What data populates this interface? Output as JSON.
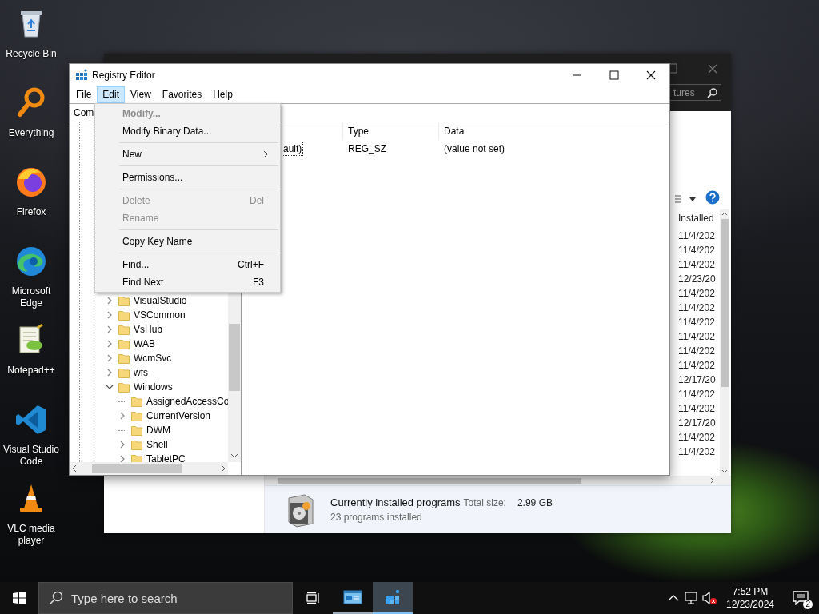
{
  "desktop_icons": [
    {
      "label": "Recycle Bin",
      "kind": "recycle"
    },
    {
      "label": "Everything",
      "kind": "everything"
    },
    {
      "label": "Firefox",
      "kind": "firefox"
    },
    {
      "label": "Microsoft Edge",
      "kind": "edge"
    },
    {
      "label": "Notepad++",
      "kind": "notepad"
    },
    {
      "label": "Visual Studio Code",
      "kind": "vscode"
    },
    {
      "label": "VLC media player",
      "kind": "vlc"
    }
  ],
  "programs_window": {
    "search": {
      "placeholder": "tures"
    },
    "column_header": "Installed",
    "dates": [
      "11/4/202",
      "11/4/202",
      "11/4/202",
      "12/23/20",
      "11/4/202",
      "11/4/202",
      "11/4/202",
      "11/4/202",
      "11/4/202",
      "11/4/202",
      "12/17/20",
      "11/4/202",
      "11/4/202",
      "12/17/20",
      "11/4/202",
      "11/4/202"
    ],
    "details": {
      "title": "Currently installed programs",
      "size_label": "Total size:",
      "size": "2.99 GB",
      "count": "23 programs installed"
    }
  },
  "registry_editor": {
    "title": "Registry Editor",
    "menus": [
      {
        "label": "File",
        "selected": false
      },
      {
        "label": "Edit",
        "selected": true
      },
      {
        "label": "View",
        "selected": false
      },
      {
        "label": "Favorites",
        "selected": false
      },
      {
        "label": "Help",
        "selected": false
      }
    ],
    "address": "Com",
    "tree": [
      {
        "label": "VisualStudio",
        "expandable": true,
        "expanded": false
      },
      {
        "label": "VSCommon",
        "expandable": true,
        "expanded": false
      },
      {
        "label": "VsHub",
        "expandable": true,
        "expanded": false
      },
      {
        "label": "WAB",
        "expandable": true,
        "expanded": false
      },
      {
        "label": "WcmSvc",
        "expandable": true,
        "expanded": false
      },
      {
        "label": "wfs",
        "expandable": true,
        "expanded": false
      },
      {
        "label": "Windows",
        "expandable": true,
        "expanded": true,
        "children": [
          {
            "label": "AssignedAccessCo",
            "expandable": false
          },
          {
            "label": "CurrentVersion",
            "expandable": true,
            "expanded": false
          },
          {
            "label": "DWM",
            "expandable": false
          },
          {
            "label": "Shell",
            "expandable": true,
            "expanded": false
          },
          {
            "label": "TabletPC",
            "expandable": true,
            "expanded": false
          }
        ]
      }
    ],
    "columns": [
      "Type",
      "Data"
    ],
    "rows": [
      {
        "name": "ault)",
        "type": "REG_SZ",
        "data": "(value not set)",
        "focused": true
      }
    ]
  },
  "edit_menu": [
    {
      "kind": "item",
      "label": "Modify...",
      "default": true,
      "disabled": true,
      "submenu": false
    },
    {
      "kind": "item",
      "label": "Modify Binary Data...",
      "default": false,
      "disabled": false,
      "submenu": false
    },
    {
      "kind": "separator"
    },
    {
      "kind": "item",
      "label": "New",
      "default": false,
      "disabled": false,
      "submenu": true
    },
    {
      "kind": "separator"
    },
    {
      "kind": "item",
      "label": "Permissions...",
      "default": false,
      "disabled": false,
      "submenu": false
    },
    {
      "kind": "separator"
    },
    {
      "kind": "item",
      "label": "Delete",
      "shortcut": "Del",
      "default": false,
      "disabled": true,
      "submenu": false
    },
    {
      "kind": "item",
      "label": "Rename",
      "default": false,
      "disabled": true,
      "submenu": false
    },
    {
      "kind": "separator"
    },
    {
      "kind": "item",
      "label": "Copy Key Name",
      "default": false,
      "disabled": false,
      "submenu": false
    },
    {
      "kind": "separator"
    },
    {
      "kind": "item",
      "label": "Find...",
      "shortcut": "Ctrl+F",
      "default": false,
      "disabled": false,
      "submenu": false
    },
    {
      "kind": "item",
      "label": "Find Next",
      "shortcut": "F3",
      "default": false,
      "disabled": false,
      "submenu": false
    }
  ],
  "taskbar": {
    "search_placeholder": "Type here to search",
    "apps": [
      {
        "kind": "control-panel",
        "active": false
      },
      {
        "kind": "regedit",
        "active": true
      }
    ],
    "time": "7:52 PM",
    "date": "12/23/2024",
    "notifications": "2"
  }
}
